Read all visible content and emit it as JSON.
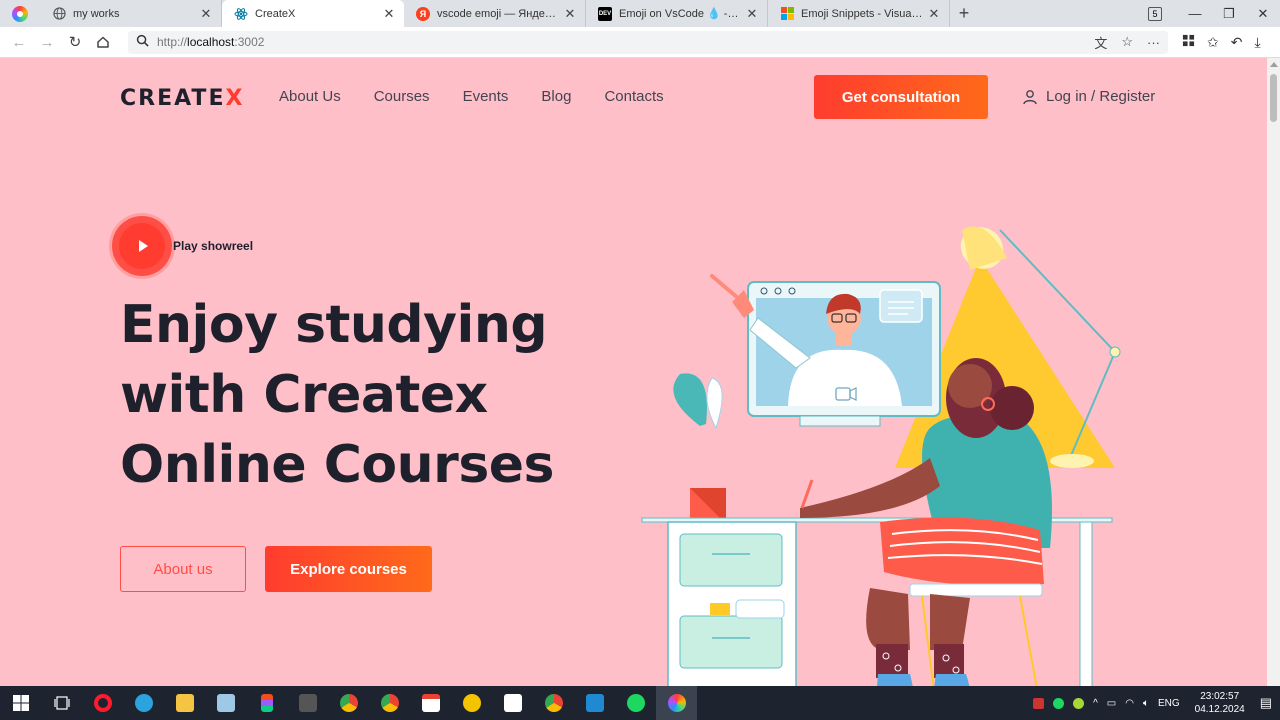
{
  "browser": {
    "tabs": [
      {
        "title": "my works",
        "favicon": "globe-icon",
        "active": false
      },
      {
        "title": "CreateX",
        "favicon": "react-icon",
        "active": true
      },
      {
        "title": "vscode emoji — Яндекс: наш",
        "favicon": "yandex-icon",
        "active": false
      },
      {
        "title": "Emoji on VsCode 💧 - DEV Co",
        "favicon": "dev-icon",
        "active": false
      },
      {
        "title": "Emoji Snippets - Visual Studio",
        "favicon": "microsoft-icon",
        "active": false
      }
    ],
    "tab_count": "5",
    "url": {
      "protocol": "http://",
      "host": "localhost",
      "port": ":3002"
    }
  },
  "site": {
    "logo_main": "CREATE",
    "logo_accent": "X",
    "menu": [
      "About Us",
      "Courses",
      "Events",
      "Blog",
      "Contacts"
    ],
    "cta_label": "Get consultation",
    "login_label": "Log in / Register"
  },
  "hero": {
    "showreel_label": "Play showreel",
    "title_lines": [
      "Enjoy studying",
      "with Createx",
      "Online Courses"
    ],
    "about_button": "About us",
    "explore_button": "Explore courses"
  },
  "colors": {
    "page_bg": "#ffbfc8",
    "accent": "#ff3c2f",
    "text_dark": "#1e212c"
  },
  "taskbar": {
    "language": "ENG",
    "time": "23:02:57",
    "date": "04.12.2024"
  }
}
